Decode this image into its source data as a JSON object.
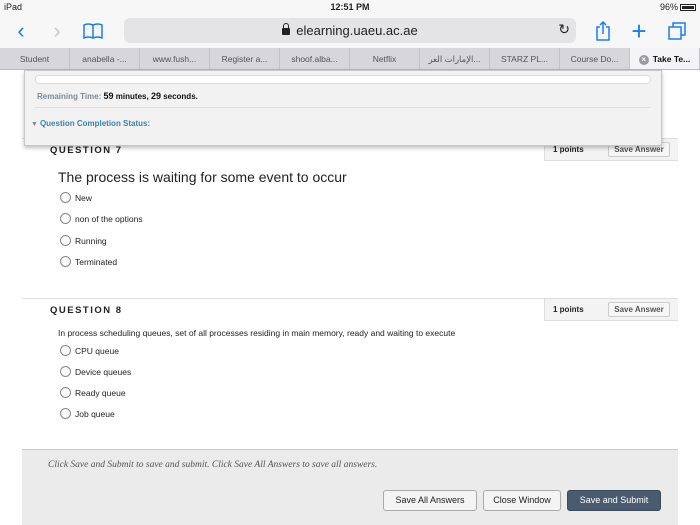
{
  "status_bar": {
    "device": "iPad",
    "time": "12:51 PM",
    "battery": "96%"
  },
  "browser": {
    "url": "elearning.uaeu.ac.ae",
    "tabs": [
      {
        "label": "Student",
        "active": false
      },
      {
        "label": "anabella -...",
        "active": false
      },
      {
        "label": "www.fush...",
        "active": false
      },
      {
        "label": "Register a...",
        "active": false
      },
      {
        "label": "shoof.alba...",
        "active": false
      },
      {
        "label": "Netflix",
        "active": false
      },
      {
        "label": "الإمارات العر...",
        "active": false
      },
      {
        "label": "STARZ PL...",
        "active": false
      },
      {
        "label": "Course Do...",
        "active": false
      },
      {
        "label": "Take Te...",
        "active": true
      }
    ]
  },
  "timer": {
    "remaining_label": "Remaining Time:",
    "minutes": "59",
    "minutes_label": "minutes,",
    "seconds": "29",
    "seconds_label": "seconds.",
    "completion_label": "Question Completion Status:"
  },
  "questions": [
    {
      "title": "QUESTION 7",
      "points": "1 points",
      "save_label": "Save Answer",
      "text": "The process is waiting for some event to occur",
      "options": [
        "New",
        "non of the options",
        "Running",
        "Terminated"
      ]
    },
    {
      "title": "QUESTION 8",
      "points": "1 points",
      "save_label": "Save Answer",
      "text": "In process scheduling queues, set of all processes residing in main memory, ready and waiting to execute",
      "options": [
        "CPU queue",
        "Device queues",
        "Ready queue",
        "Job queue"
      ]
    }
  ],
  "footer": {
    "note": "Click Save and Submit to save and submit. Click Save All Answers to save all answers.",
    "save_all": "Save All Answers",
    "close_window": "Close Window",
    "save_submit": "Save and Submit"
  }
}
